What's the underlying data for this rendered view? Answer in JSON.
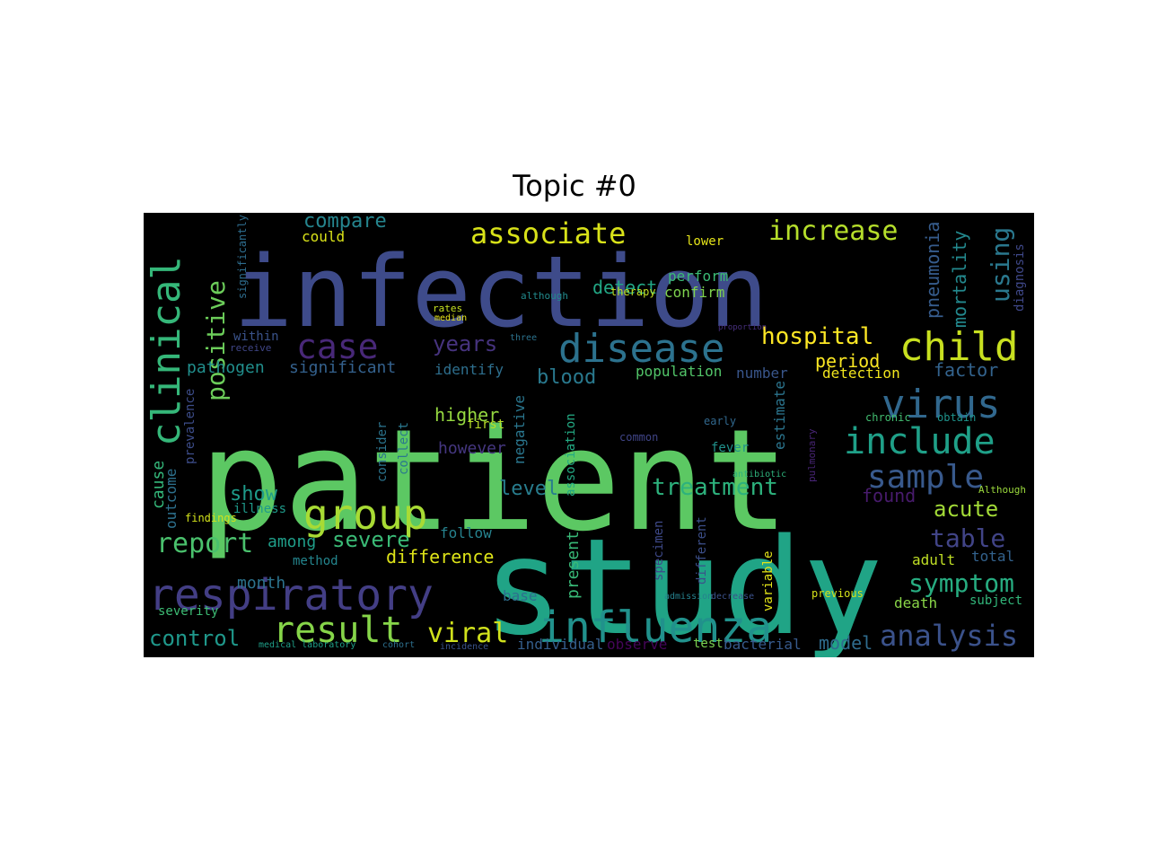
{
  "chart_data": {
    "type": "wordcloud",
    "title": "Topic #0",
    "background": "#000000",
    "colormap": "viridis",
    "words": [
      {
        "text": "patient",
        "size": 1.0,
        "color": "#5cc863"
      },
      {
        "text": "infection",
        "size": 0.92,
        "color": "#3e4b8a"
      },
      {
        "text": "study",
        "size": 0.9,
        "color": "#20a486"
      },
      {
        "text": "respiratory",
        "size": 0.42,
        "color": "#433e85"
      },
      {
        "text": "influenza",
        "size": 0.42,
        "color": "#21918c"
      },
      {
        "text": "clinical",
        "size": 0.4,
        "color": "#35b779"
      },
      {
        "text": "disease",
        "size": 0.4,
        "color": "#2c728e"
      },
      {
        "text": "group",
        "size": 0.38,
        "color": "#a8db34"
      },
      {
        "text": "child",
        "size": 0.36,
        "color": "#c8e020"
      },
      {
        "text": "virus",
        "size": 0.36,
        "color": "#31688e"
      },
      {
        "text": "case",
        "size": 0.34,
        "color": "#482878"
      },
      {
        "text": "include",
        "size": 0.34,
        "color": "#1fa088"
      },
      {
        "text": "result",
        "size": 0.34,
        "color": "#86d549"
      },
      {
        "text": "sample",
        "size": 0.32,
        "color": "#38598c"
      },
      {
        "text": "analysis",
        "size": 0.28,
        "color": "#3b528b"
      },
      {
        "text": "associate",
        "size": 0.28,
        "color": "#d8e219"
      },
      {
        "text": "increase",
        "size": 0.28,
        "color": "#b5de2b"
      },
      {
        "text": "positive",
        "size": 0.26,
        "color": "#6ccd5a"
      },
      {
        "text": "symptom",
        "size": 0.26,
        "color": "#27ad81"
      },
      {
        "text": "viral",
        "size": 0.26,
        "color": "#d0e11c"
      },
      {
        "text": "hospital",
        "size": 0.24,
        "color": "#fde725"
      },
      {
        "text": "report",
        "size": 0.24,
        "color": "#4ac16d"
      },
      {
        "text": "table",
        "size": 0.24,
        "color": "#414487"
      },
      {
        "text": "severe",
        "size": 0.22,
        "color": "#3aba76"
      },
      {
        "text": "treatment",
        "size": 0.22,
        "color": "#2db27d"
      },
      {
        "text": "control",
        "size": 0.22,
        "color": "#1f988b"
      },
      {
        "text": "compare",
        "size": 0.2,
        "color": "#25858e"
      },
      {
        "text": "using",
        "size": 0.2,
        "color": "#2a788e"
      },
      {
        "text": "years",
        "size": 0.2,
        "color": "#46337e"
      },
      {
        "text": "mortality",
        "size": 0.19,
        "color": "#23898e"
      },
      {
        "text": "pneumonia",
        "size": 0.19,
        "color": "#365c8d"
      },
      {
        "text": "acute",
        "size": 0.2,
        "color": "#a2da37"
      },
      {
        "text": "higher",
        "size": 0.18,
        "color": "#95d840"
      },
      {
        "text": "level",
        "size": 0.18,
        "color": "#287d8e"
      },
      {
        "text": "show",
        "size": 0.18,
        "color": "#1e9b8a"
      },
      {
        "text": "model",
        "size": 0.18,
        "color": "#2f6c8e"
      },
      {
        "text": "factor",
        "size": 0.18,
        "color": "#33638d"
      },
      {
        "text": "blood",
        "size": 0.18,
        "color": "#29798e"
      },
      {
        "text": "detect",
        "size": 0.18,
        "color": "#22a785"
      },
      {
        "text": "period",
        "size": 0.18,
        "color": "#fbe723"
      },
      {
        "text": "difference",
        "size": 0.16,
        "color": "#dde318"
      },
      {
        "text": "significant",
        "size": 0.16,
        "color": "#34618d"
      },
      {
        "text": "pathogen",
        "size": 0.15,
        "color": "#218f8d"
      },
      {
        "text": "among",
        "size": 0.15,
        "color": "#1f9e89"
      },
      {
        "text": "month",
        "size": 0.15,
        "color": "#2c738e"
      },
      {
        "text": "found",
        "size": 0.15,
        "color": "#481b6d"
      },
      {
        "text": "however",
        "size": 0.15,
        "color": "#453781"
      },
      {
        "text": "follow",
        "size": 0.13,
        "color": "#26828e"
      },
      {
        "text": "identify",
        "size": 0.13,
        "color": "#2e6f8e"
      },
      {
        "text": "population",
        "size": 0.13,
        "color": "#52c569"
      },
      {
        "text": "perform",
        "size": 0.12,
        "color": "#3bbb75"
      },
      {
        "text": "confirm",
        "size": 0.12,
        "color": "#7fd34e"
      },
      {
        "text": "could",
        "size": 0.12,
        "color": "#dae319"
      },
      {
        "text": "lower",
        "size": 0.12,
        "color": "#e5e419"
      },
      {
        "text": "number",
        "size": 0.12,
        "color": "#39568c"
      },
      {
        "text": "detection",
        "size": 0.12,
        "color": "#f1e51d"
      },
      {
        "text": "diagnosis",
        "size": 0.1,
        "color": "#3f4889"
      },
      {
        "text": "estimate",
        "size": 0.1,
        "color": "#2b758e"
      },
      {
        "text": "negative",
        "size": 0.1,
        "color": "#2a768e"
      },
      {
        "text": "present",
        "size": 0.12,
        "color": "#38b977"
      },
      {
        "text": "association",
        "size": 0.1,
        "color": "#23a983"
      },
      {
        "text": "cause",
        "size": 0.12,
        "color": "#34b679"
      },
      {
        "text": "outcome",
        "size": 0.1,
        "color": "#2d718e"
      },
      {
        "text": "prevalence",
        "size": 0.1,
        "color": "#3d4d8a"
      },
      {
        "text": "specimen",
        "size": 0.1,
        "color": "#3e4989"
      },
      {
        "text": "different",
        "size": 0.1,
        "color": "#3c4f8a"
      },
      {
        "text": "variable",
        "size": 0.1,
        "color": "#e2e418"
      },
      {
        "text": "adult",
        "size": 0.1,
        "color": "#c0df25"
      },
      {
        "text": "total",
        "size": 0.1,
        "color": "#33628d"
      },
      {
        "text": "death",
        "size": 0.1,
        "color": "#89d548"
      },
      {
        "text": "subject",
        "size": 0.09,
        "color": "#32b67a"
      },
      {
        "text": "method",
        "size": 0.09,
        "color": "#24868e"
      },
      {
        "text": "individual",
        "size": 0.1,
        "color": "#355f8d"
      },
      {
        "text": "observe",
        "size": 0.1,
        "color": "#450559"
      },
      {
        "text": "test",
        "size": 0.09,
        "color": "#7ad151"
      },
      {
        "text": "bacterial",
        "size": 0.1,
        "color": "#375a8c"
      },
      {
        "text": "base",
        "size": 0.09,
        "color": "#2e6e8e"
      },
      {
        "text": "severity",
        "size": 0.08,
        "color": "#3dbc74"
      },
      {
        "text": "findings",
        "size": 0.07,
        "color": "#d2e21b"
      },
      {
        "text": "illness",
        "size": 0.08,
        "color": "#1f9a8a"
      },
      {
        "text": "consider",
        "size": 0.07,
        "color": "#2b748e"
      },
      {
        "text": "within",
        "size": 0.08,
        "color": "#3a538b"
      },
      {
        "text": "first",
        "size": 0.07,
        "color": "#b8de29"
      },
      {
        "text": "common",
        "size": 0.07,
        "color": "#404588"
      },
      {
        "text": "fever",
        "size": 0.07,
        "color": "#20928c"
      },
      {
        "text": "early",
        "size": 0.07,
        "color": "#31688e"
      },
      {
        "text": "chronic",
        "size": 0.06,
        "color": "#42be71"
      },
      {
        "text": "obtain",
        "size": 0.06,
        "color": "#1f948c"
      },
      {
        "text": "previous",
        "size": 0.06,
        "color": "#d5e21a"
      },
      {
        "text": "collect",
        "size": 0.06,
        "color": "#2a778e"
      },
      {
        "text": "therapy",
        "size": 0.06,
        "color": "#c2df23"
      },
      {
        "text": "admission",
        "size": 0.05,
        "color": "#26828e"
      },
      {
        "text": "decrease",
        "size": 0.05,
        "color": "#3b528b"
      },
      {
        "text": "significantly",
        "size": 0.05,
        "color": "#2e6d8e"
      },
      {
        "text": "receive",
        "size": 0.05,
        "color": "#404688"
      },
      {
        "text": "pulmonary",
        "size": 0.05,
        "color": "#482576"
      },
      {
        "text": "Although",
        "size": 0.05,
        "color": "#9bd93c"
      },
      {
        "text": "rates",
        "size": 0.05,
        "color": "#c5e021"
      },
      {
        "text": "median",
        "size": 0.04,
        "color": "#e7e419"
      },
      {
        "text": "although",
        "size": 0.05,
        "color": "#228b8d"
      },
      {
        "text": "medical laboratory",
        "size": 0.04,
        "color": "#1f9f88"
      },
      {
        "text": "cohort",
        "size": 0.04,
        "color": "#2d708e"
      },
      {
        "text": "incidence",
        "size": 0.04,
        "color": "#3a548c"
      },
      {
        "text": "antibiotic",
        "size": 0.04,
        "color": "#2eb37c"
      },
      {
        "text": "three",
        "size": 0.04,
        "color": "#2c738e"
      },
      {
        "text": "proportion",
        "size": 0.03,
        "color": "#472f7d"
      }
    ]
  }
}
